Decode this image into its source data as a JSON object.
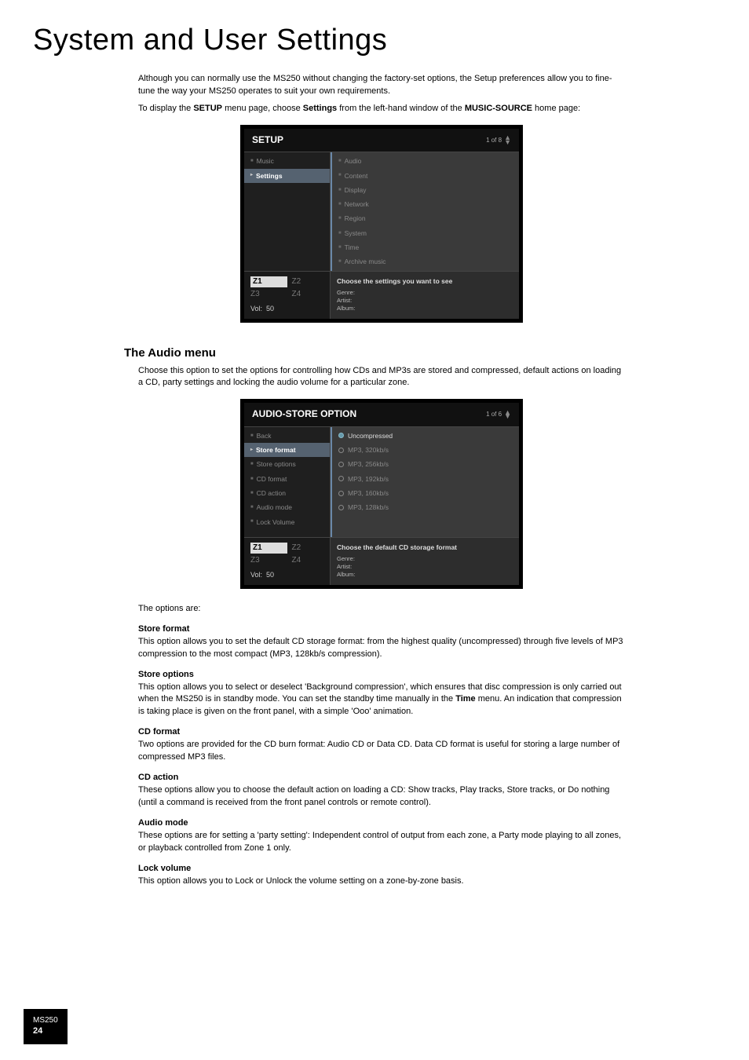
{
  "page": {
    "title": "System and User Settings",
    "corner_model": "MS250",
    "corner_page": "24"
  },
  "intro": {
    "p1": "Although you can normally use the MS250 without changing the factory-set options, the Setup preferences allow you to fine-tune the way your MS250 operates to suit your own requirements.",
    "p2a": "To display the ",
    "p2b": "SETUP",
    "p2c": " menu page, choose ",
    "p2d": "Settings",
    "p2e": " from the left-hand window of the ",
    "p2f": "MUSIC-SOURCE",
    "p2g": " home page:"
  },
  "setup_screen": {
    "header": "SETUP",
    "count": "1 of 8",
    "left_items": [
      "Music",
      "Settings"
    ],
    "left_selected_index": 1,
    "right_items": [
      "Audio",
      "Content",
      "Display",
      "Network",
      "Region",
      "System",
      "Time",
      "Archive music"
    ],
    "footer_msg": "Choose the settings you want to see",
    "zones": [
      "Z1",
      "Z2",
      "Z3",
      "Z4"
    ],
    "active_zone_index": 0,
    "vol_label": "Vol:",
    "vol_value": "50",
    "meta": [
      "Genre:",
      "Artist:",
      "Album:"
    ]
  },
  "audio_section": {
    "heading": "The Audio menu",
    "desc": "Choose this option to set the options for controlling how CDs and MP3s are stored and compressed, default actions on loading a CD, party settings and locking the audio volume for a particular zone."
  },
  "audio_screen": {
    "header": "AUDIO-STORE OPTION",
    "count": "1 of 6",
    "left_items": [
      "Back",
      "Store format",
      "Store options",
      "CD format",
      "CD action",
      "Audio mode",
      "Lock Volume"
    ],
    "left_selected_index": 1,
    "right_items": [
      "Uncompressed",
      "MP3, 320kb/s",
      "MP3, 256kb/s",
      "MP3, 192kb/s",
      "MP3, 160kb/s",
      "MP3, 128kb/s"
    ],
    "right_selected_index": 0,
    "footer_msg": "Choose the default CD storage format",
    "zones": [
      "Z1",
      "Z2",
      "Z3",
      "Z4"
    ],
    "active_zone_index": 0,
    "vol_label": "Vol:",
    "vol_value": "50",
    "meta": [
      "Genre:",
      "Artist:",
      "Album:"
    ]
  },
  "options_intro": "The options are:",
  "options": {
    "store_format": {
      "name": "Store format",
      "desc": "This option allows you to set the default CD storage format: from the highest quality (uncompressed) through five levels of MP3 compression to the most compact (MP3, 128kb/s compression)."
    },
    "store_options": {
      "name": "Store options",
      "desc_a": "This option allows you to select or deselect 'Background compression', which ensures that disc compression is only carried out when the MS250 is in standby mode. You can set the standby time manually in the ",
      "desc_b": "Time",
      "desc_c": " menu. An indication that compression is taking place is given on the front panel, with a simple 'Ooo' animation."
    },
    "cd_format": {
      "name": "CD format",
      "desc": "Two options are provided for the CD burn format: Audio CD or Data CD. Data CD format is useful for storing a large number of compressed MP3 files."
    },
    "cd_action": {
      "name": "CD action",
      "desc": "These options allow you to choose the default action on loading a CD: Show tracks, Play tracks, Store tracks, or Do nothing (until a command is received from the front panel controls or remote control)."
    },
    "audio_mode": {
      "name": "Audio mode",
      "desc": "These options are for setting a 'party setting': Independent control of output from each zone, a Party mode playing to all zones, or playback controlled from Zone 1 only."
    },
    "lock_volume": {
      "name": "Lock volume",
      "desc": "This option allows you to Lock or Unlock the volume setting on a zone-by-zone basis."
    }
  }
}
